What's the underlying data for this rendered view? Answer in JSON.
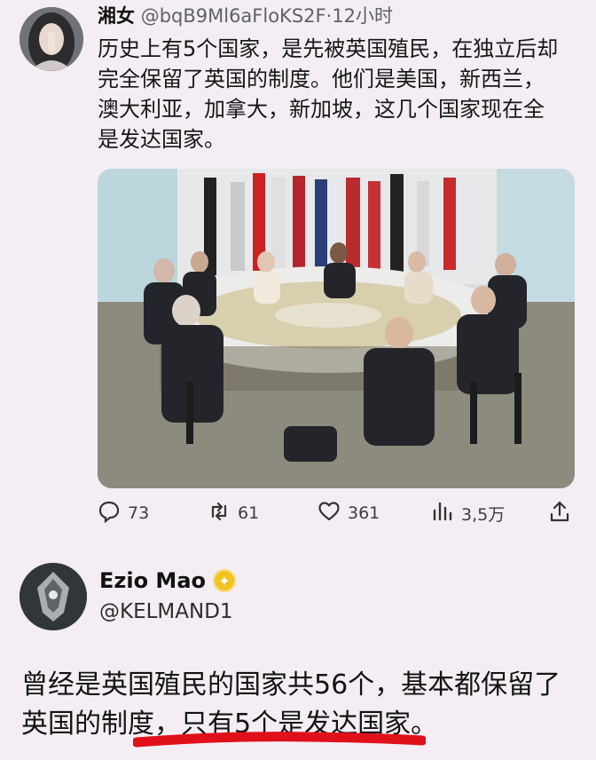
{
  "tweet": {
    "author_name": "湘女",
    "handle": "@bqB9Ml6aFloKS2F",
    "time": "·12小时",
    "text": "历史上有5个国家，是先被英国殖民，在独立后却完全保留了英国的制度。他们是美国，新西兰，澳大利亚，加拿大，新加坡，这几个国家现在全是发达国家。",
    "stats": {
      "replies": "73",
      "retweets": "61",
      "likes": "361",
      "views": "3,5万"
    }
  },
  "reply": {
    "author_name": "Ezio Mao",
    "handle": "@KELMAND1",
    "text": "曾经是英国殖民的国家共56个，基本都保留了英国的制度，只有5个是发达国家。"
  },
  "colors": {
    "background": "#f4eef4",
    "underline": "#e0101a",
    "verified": "#f2c21d"
  },
  "icons": [
    "reply-icon",
    "retweet-icon",
    "like-icon",
    "views-icon",
    "share-icon",
    "verified-badge-icon"
  ]
}
